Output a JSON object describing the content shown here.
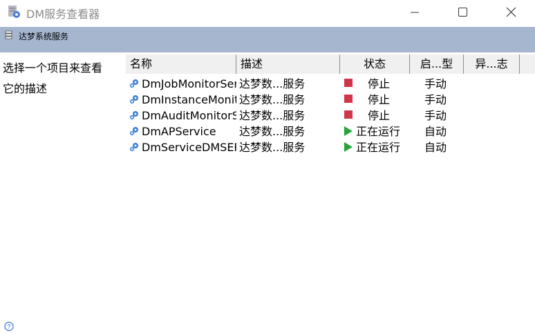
{
  "window": {
    "title": "DM服务查看器"
  },
  "toolbar": {
    "label": "达梦系统服务"
  },
  "left_panel": {
    "line1": "选择一个项目来查看",
    "line2": "它的描述"
  },
  "table": {
    "headers": {
      "name": "名称",
      "description": "描述",
      "status": "状态",
      "startup": "启...型",
      "event": "异...志"
    },
    "rows": [
      {
        "name": "DmJobMonitorService",
        "description": "达梦数...服务",
        "status": "停止",
        "status_kind": "stopped",
        "startup": "手动"
      },
      {
        "name": "DmInstanceMonitorService",
        "description": "达梦数...服务",
        "status": "停止",
        "status_kind": "stopped",
        "startup": "手动"
      },
      {
        "name": "DmAuditMonitorService",
        "description": "达梦数...服务",
        "status": "停止",
        "status_kind": "stopped",
        "startup": "手动"
      },
      {
        "name": "DmAPService",
        "description": "达梦数...服务",
        "status": "正在运行",
        "status_kind": "running",
        "startup": "自动"
      },
      {
        "name": "DmServiceDMSERVER",
        "description": "达梦数...服务",
        "status": "正在运行",
        "status_kind": "running",
        "startup": "自动"
      }
    ]
  },
  "colors": {
    "stopped": "#d0364a",
    "running": "#26a53a",
    "strip": "#a6b6cf"
  },
  "icons": {
    "app": "dm-app-icon",
    "service": "gear-icon",
    "help": "help-icon"
  }
}
